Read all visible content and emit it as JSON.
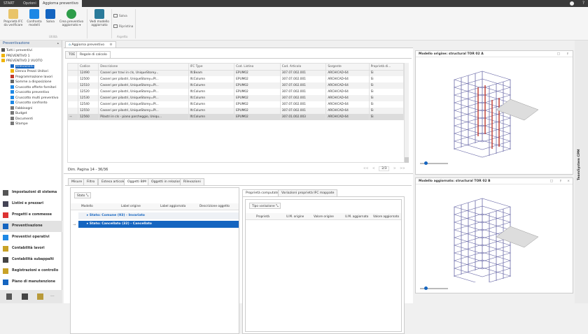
{
  "tabs": [
    "START",
    "Opzioni",
    "Aggiorna preventivo"
  ],
  "ribbon": {
    "buttons": [
      {
        "label": "Proprietà IFC da verificare",
        "icon": "ifc-properties-icon"
      },
      {
        "label": "Confronta modelli",
        "icon": "compare-models-icon"
      },
      {
        "label": "Salva",
        "icon": "save-icon"
      },
      {
        "label": "Crea preventivo aggiornato ▾",
        "icon": "create-estimate-icon"
      },
      {
        "label": "Vedi modello aggiornato",
        "icon": "view-model-icon"
      }
    ],
    "group_utilita": "Utilità",
    "group_aspetto": "Aspetto",
    "small": [
      "Salva",
      "Ripristina"
    ]
  },
  "left": {
    "header": "Preventivazione",
    "tree": [
      {
        "label": "Tutti i preventivi",
        "lvl": 0
      },
      {
        "label": "PREVENTIVO 1",
        "lvl": 0
      },
      {
        "label": "PREVENTIVO 2 VUOTO",
        "lvl": 0
      },
      {
        "label": "Rilevazioni",
        "lvl": 1,
        "selected": true
      },
      {
        "label": "Elenco Prezzi Unitari",
        "lvl": 1
      },
      {
        "label": "Programmazione lavori",
        "lvl": 1
      },
      {
        "label": "Somme a disposizione",
        "lvl": 1
      },
      {
        "label": "Cruscotto offerte fornitori",
        "lvl": 1
      },
      {
        "label": "Cruscotto preventivo",
        "lvl": 1
      },
      {
        "label": "Cruscotto multi preventivo",
        "lvl": 1
      },
      {
        "label": "Cruscotto confronto",
        "lvl": 1
      },
      {
        "label": "Fabbisogni",
        "lvl": 1
      },
      {
        "label": "Budget",
        "lvl": 1
      },
      {
        "label": "Documenti",
        "lvl": 1
      },
      {
        "label": "Stampe",
        "lvl": 1
      }
    ],
    "nav": [
      "Impostazioni di sistema",
      "Listini e prezzari",
      "Progetti e commesse",
      "Preventivazione",
      "Preventivi operativi",
      "Contabilità lavori",
      "Contabilità subappalti",
      "Registrazioni e controllo",
      "Piano di manutenzione"
    ],
    "more": "..."
  },
  "doc_tab": "Aggiorna preventivo",
  "inner_tabs": [
    "TOE",
    "Regole di calcolo"
  ],
  "grid": {
    "columns": [
      "Codice",
      "Descrizione",
      "IFC Type",
      "Cod. Listino",
      "Cod. Articolo",
      "Sorgente",
      "Proprietà di..."
    ],
    "rows": [
      [
        "12490",
        "Casseri per travi in cls, UniqueStorey...",
        "IfcBeam",
        "EPUM02",
        "307.07.002.001",
        "ARCHICAD-64",
        "Sì"
      ],
      [
        "12500",
        "Casseri per pilastri, UniqueStorey=PI...",
        "IfcColumn",
        "EPUM02",
        "307.07.002.001",
        "ARCHICAD-64",
        "Sì"
      ],
      [
        "12510",
        "Casseri per pilastri, UniqueStorey=PI...",
        "IfcColumn",
        "EPUM02",
        "307.07.002.001",
        "ARCHICAD-64",
        "Sì"
      ],
      [
        "12520",
        "Casseri per pilastri, UniqueStorey=PI...",
        "IfcColumn",
        "EPUM02",
        "307.07.002.001",
        "ARCHICAD-64",
        "Sì"
      ],
      [
        "12530",
        "Casseri per pilastri, UniqueStorey=PI...",
        "IfcColumn",
        "EPUM02",
        "307.07.002.001",
        "ARCHICAD-64",
        "Sì"
      ],
      [
        "12540",
        "Casseri per pilastri, UniqueStorey=PI...",
        "IfcColumn",
        "EPUM02",
        "307.07.002.001",
        "ARCHICAD-64",
        "Sì"
      ],
      [
        "12550",
        "Casseri per pilastri, UniqueStorey=PI...",
        "IfcColumn",
        "EPUM02",
        "307.07.002.001",
        "ARCHICAD-64",
        "Sì"
      ],
      [
        "12560",
        "Pilastri in cls - piano parcheggio, Uniqu...",
        "IfcColumn",
        "EPUM02",
        "307.01.002.003",
        "ARCHICAD-64",
        "Sì"
      ]
    ],
    "current_marker": "→",
    "footer": "Dim. Pagina 14 - 36/36",
    "pager": {
      "first": "<<",
      "prev": "<",
      "page": "2/3",
      "next": ">",
      "last": ">>"
    }
  },
  "bottom_tabs": [
    "Misure",
    "Filtro",
    "Estesa articolo",
    "Oggetti BIM",
    "Oggetti in relazione",
    "Rilevazioni"
  ],
  "bim": {
    "group_chip": "Stato",
    "columns": [
      "Modello",
      "Label origine",
      "Label aggiornata",
      "Descrizione oggetto"
    ],
    "groups": [
      "Stato: Comune  (93) - Invariato",
      "Stato: Cancellato  (32) - Cancellato"
    ]
  },
  "props": {
    "tabs": [
      "Proprietà computate",
      "Variazioni proprietà IFC mappate"
    ],
    "group_chip": "Tipo variazione",
    "columns": [
      "Proprietà",
      "U.M. origine",
      "Valore origine",
      "U.M. aggiornato",
      "Valore aggiornato"
    ]
  },
  "models": [
    {
      "title": "Modello origine: structural TOR 02 A",
      "slider": 0.15
    },
    {
      "title": "Modello aggiornato: structural TOR 02 B",
      "slider": 0.15
    }
  ],
  "side_strip": "TeamSystem CPM",
  "colors": {
    "accent": "#1565c0",
    "topbar": "#3b3b3b",
    "structure": "#6a6aa8",
    "changed": "#c0392b"
  }
}
